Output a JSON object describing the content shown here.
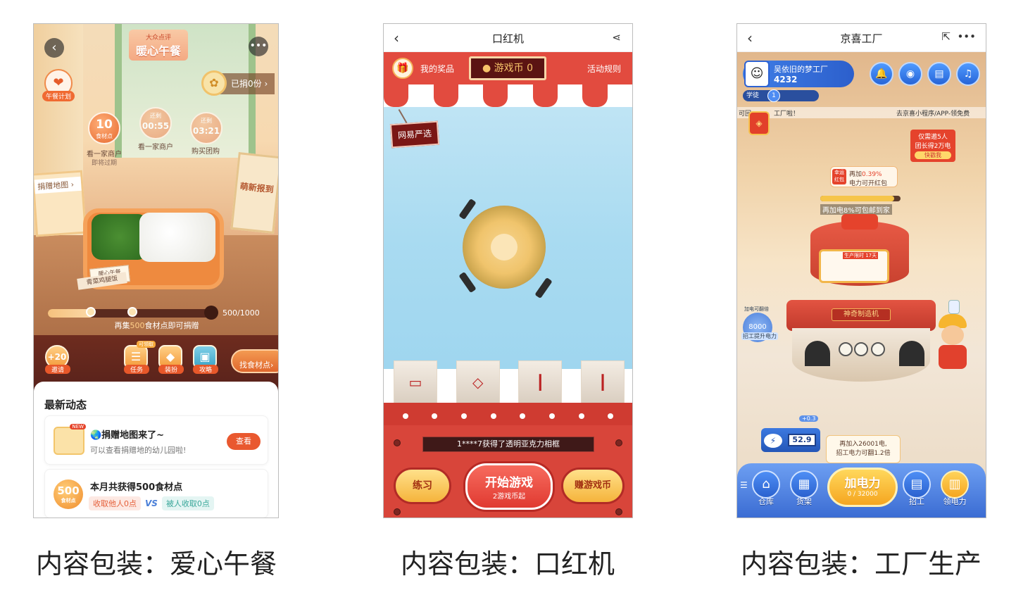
{
  "captions": [
    "内容包装：爱心午餐",
    "内容包装：口红机",
    "内容包装：工厂生产"
  ],
  "lunch": {
    "logo_small": "大众点评",
    "logo_big": "暖心午餐",
    "plan_label": "午餐计划",
    "donated_text": "已捐0份 ›",
    "balls": [
      {
        "num": "10",
        "label": "食材点",
        "caption": "看一家商户",
        "sub": "即将过期"
      },
      {
        "num": "00:55",
        "label": "还剩",
        "caption": "看一家商户",
        "sub": ""
      },
      {
        "num": "03:21",
        "label": "还剩",
        "caption": "购买团购",
        "sub": ""
      }
    ],
    "map_label": "捐赠地图 ›",
    "card_text": "萌新报到",
    "box_tag": "暖心午餐",
    "box_tag2": "青菜鸡腿饭",
    "progress": {
      "value": 500,
      "max": 1000,
      "text": "500/1000"
    },
    "hint_prefix": "再集",
    "hint_highlight": "500",
    "hint_suffix": "食材点即可捐赠",
    "actions": [
      {
        "icon": "+20",
        "label": "邀请",
        "badge": ""
      },
      {
        "icon": "☰",
        "label": "任务",
        "badge": "可领取"
      },
      {
        "icon": "◆",
        "label": "装扮",
        "badge": ""
      },
      {
        "icon": "▣",
        "label": "攻略",
        "badge": ""
      }
    ],
    "find_label": "找食材点›",
    "feed_title": "最新动态",
    "feed_item1": {
      "badge": "NEW",
      "title": "🌏捐赠地图来了~",
      "subtitle": "可以查看捐赠地的幼儿园啦!",
      "button": "查看"
    },
    "feed_item2": {
      "coin": "500",
      "coin_label": "食材点",
      "title": "本月共获得500食材点",
      "left_pill": "收取他人0点",
      "vs": "VS",
      "right_pill": "被人收取0点"
    },
    "colors": {
      "accent": "#e9582f"
    }
  },
  "lipstick": {
    "nav_title": "口红机",
    "my_prizes": "我的奖品",
    "coin_label": "● 游戏币  0",
    "rules": "活动规则",
    "sign": "网易严选",
    "ticker": "1****7获得了透明亚克力相框",
    "practice": "练习",
    "start_main": "开始游戏",
    "start_sub": "2游戏币起",
    "earn": "赚游戏币",
    "colors": {
      "accent": "#e24b3f",
      "awning_red": "#e24b3f",
      "awning_white": "#ffffff"
    }
  },
  "factory": {
    "nav_title": "京喜工厂",
    "user_name": "吴依旧的梦工厂",
    "user_points": "4232",
    "level_label": "学徒",
    "level_num": "1",
    "ticker_left": "可回",
    "ticker_mid": "工厂啦！",
    "ticker_right": "去京喜小程序/APP-领免费",
    "banner_line1": "仅需邀5人",
    "banner_line2": "团长得2万电",
    "banner_btn": "快戳我",
    "tip_icon": "幸运红包",
    "tip_prefix": "再加",
    "tip_pct": "0.39%",
    "tip_line2": "电力可开红包",
    "bar_fill": 0.92,
    "bar_text": "再加电8%可包邮到家",
    "prod_tag": "生产限时 17天",
    "machine_label": "神奇制造机",
    "electric_value": "8000",
    "electric_top": "加电可翻倍",
    "electric_label": "招工提升电力",
    "battery_value": "52.9",
    "battery_plus": "+0.3",
    "hint_line1": "再加入26001电,",
    "hint_line2": "招工电力可翻1.2倍",
    "power_main": "加电力",
    "power_sub": "0 / 32000",
    "dock": [
      {
        "icon": "⌂",
        "label": "仓库"
      },
      {
        "icon": "▦",
        "label": "货架"
      },
      {
        "icon": "▤",
        "label": "招工"
      },
      {
        "icon": "▥",
        "label": "领电力"
      }
    ]
  }
}
